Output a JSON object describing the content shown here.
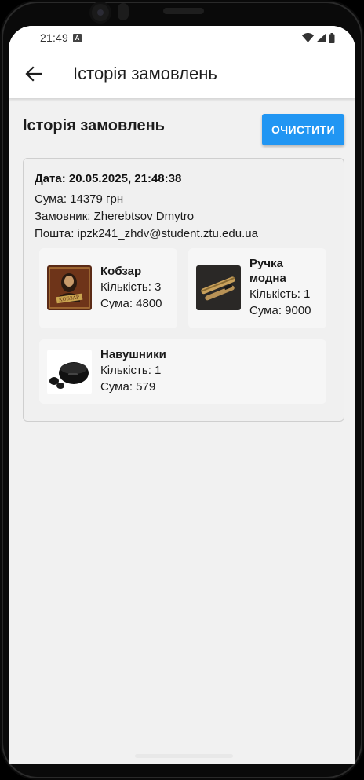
{
  "status_bar": {
    "time": "21:49",
    "notification_icon": "a-notification-icon",
    "icons": [
      "wifi-icon",
      "signal-icon",
      "battery-icon"
    ]
  },
  "app_bar": {
    "title": "Історія замовлень",
    "back_icon": "arrow-left-icon"
  },
  "page": {
    "title": "Історія замовлень",
    "clear_button": "ОЧИСТИТИ"
  },
  "orders": [
    {
      "date": "Дата: 20.05.2025, 21:48:38",
      "sum": "Сума: 14379 грн",
      "customer": "Замовник: Zherebtsov Dmytro",
      "email": "Пошта: ipzk241_zhdv@student.ztu.edu.ua",
      "items": [
        {
          "name": "Кобзар",
          "quantity": "Кількість: 3",
          "sum": "Сума: 4800",
          "icon": "book-cover-image"
        },
        {
          "name": "Ручка модна",
          "quantity": "Кількість: 1",
          "sum": "Сума: 9000",
          "icon": "fountain-pen-image"
        },
        {
          "name": "Навушники",
          "quantity": "Кількість: 1",
          "sum": "Сума: 579",
          "icon": "earbuds-image"
        }
      ]
    }
  ],
  "colors": {
    "accent": "#2196f3",
    "background": "#f1f1f1",
    "app_bar": "#ffffff"
  }
}
